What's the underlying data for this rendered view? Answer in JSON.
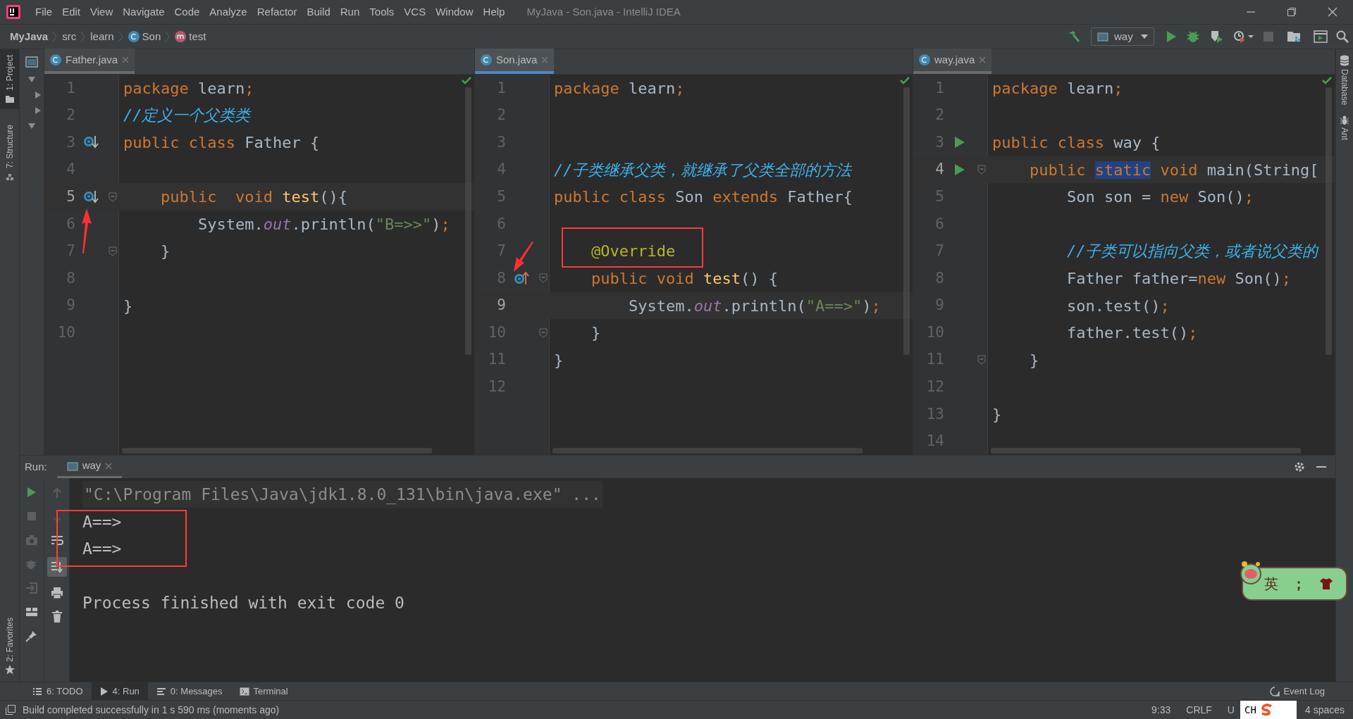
{
  "window": {
    "title": "MyJava - Son.java - IntelliJ IDEA"
  },
  "menu": [
    "File",
    "Edit",
    "View",
    "Navigate",
    "Code",
    "Analyze",
    "Refactor",
    "Build",
    "Run",
    "Tools",
    "VCS",
    "Window",
    "Help"
  ],
  "breadcrumb": [
    {
      "label": "MyJava",
      "kind": "project"
    },
    {
      "label": "src",
      "kind": "folder"
    },
    {
      "label": "learn",
      "kind": "folder"
    },
    {
      "label": "Son",
      "kind": "class"
    },
    {
      "label": "test",
      "kind": "method"
    }
  ],
  "run_config": "way",
  "left_tools": [
    {
      "label": "1: Project",
      "selected": true
    },
    {
      "label": "7: Structure",
      "selected": false
    }
  ],
  "favorites": "2: Favorites",
  "right_tools": [
    "Database",
    "Ant"
  ],
  "editors": [
    {
      "tab": "Father.java",
      "selected": false,
      "lines": [
        {
          "number": "1",
          "kind": "plain",
          "current": false,
          "fold": false,
          "tokens": [
            {
              "text": "package",
              "kind": "keyword"
            },
            {
              "text": " learn",
              "kind": "plain"
            },
            {
              "text": ";",
              "kind": "keyword"
            }
          ]
        },
        {
          "number": "2",
          "kind": "plain",
          "current": false,
          "fold": false,
          "tokens": [
            {
              "text": "//定义一个父类类",
              "kind": "comment"
            }
          ]
        },
        {
          "number": "3",
          "kind": "overridden",
          "current": false,
          "fold": false,
          "tokens": [
            {
              "text": "public class",
              "kind": "keyword"
            },
            {
              "text": " Father {",
              "kind": "plain"
            }
          ]
        },
        {
          "number": "4",
          "kind": "plain",
          "current": false,
          "fold": false
        },
        {
          "number": "5",
          "kind": "overridden",
          "current": true,
          "fold": true,
          "tokens": [
            {
              "text": "    public  void",
              "kind": "keyword"
            },
            {
              "text": " test",
              "kind": "method"
            },
            {
              "text": "(){",
              "kind": "plain"
            }
          ]
        },
        {
          "number": "6",
          "kind": "plain",
          "current": false,
          "fold": false,
          "tokens": [
            {
              "text": "        System.",
              "kind": "plain"
            },
            {
              "text": "out",
              "kind": "field"
            },
            {
              "text": ".println(",
              "kind": "plain"
            },
            {
              "text": "\"B=>>\"",
              "kind": "string"
            },
            {
              "text": ")",
              "kind": "plain"
            },
            {
              "text": ";",
              "kind": "keyword"
            }
          ]
        },
        {
          "number": "7",
          "kind": "plain",
          "current": false,
          "fold": true,
          "tokens": [
            {
              "text": "    }",
              "kind": "plain"
            }
          ]
        },
        {
          "number": "8",
          "kind": "plain",
          "current": false,
          "fold": false
        },
        {
          "number": "9",
          "kind": "plain",
          "current": false,
          "fold": false,
          "tokens": [
            {
              "text": "}",
              "kind": "plain"
            }
          ]
        },
        {
          "number": "10",
          "kind": "plain",
          "current": false,
          "fold": false
        }
      ]
    },
    {
      "tab": "Son.java",
      "selected": true,
      "lines": [
        {
          "number": "1",
          "kind": "plain",
          "current": false,
          "fold": false,
          "tokens": [
            {
              "text": "package",
              "kind": "keyword"
            },
            {
              "text": " learn",
              "kind": "plain"
            },
            {
              "text": ";",
              "kind": "keyword"
            }
          ]
        },
        {
          "number": "2",
          "kind": "plain",
          "current": false,
          "fold": false
        },
        {
          "number": "3",
          "kind": "plain",
          "current": false,
          "fold": false
        },
        {
          "number": "4",
          "kind": "plain",
          "current": false,
          "fold": false,
          "tokens": [
            {
              "text": "//子类继承父类，就继承了父类全部的方法",
              "kind": "comment"
            }
          ]
        },
        {
          "number": "5",
          "kind": "plain",
          "current": false,
          "fold": false,
          "tokens": [
            {
              "text": "public class",
              "kind": "keyword"
            },
            {
              "text": " Son ",
              "kind": "plain"
            },
            {
              "text": "extends",
              "kind": "keyword"
            },
            {
              "text": " Father{",
              "kind": "plain"
            }
          ]
        },
        {
          "number": "6",
          "kind": "plain",
          "current": false,
          "fold": false
        },
        {
          "number": "7",
          "kind": "plain",
          "current": false,
          "fold": false,
          "tokens": [
            {
              "text": "    @Override",
              "kind": "annotation"
            }
          ]
        },
        {
          "number": "8",
          "kind": "overrides",
          "current": false,
          "fold": true,
          "tokens": [
            {
              "text": "    public void",
              "kind": "keyword"
            },
            {
              "text": " test",
              "kind": "method"
            },
            {
              "text": "() {",
              "kind": "plain"
            }
          ]
        },
        {
          "number": "9",
          "kind": "plain",
          "current": true,
          "fold": false,
          "tokens": [
            {
              "text": "        System.",
              "kind": "plain"
            },
            {
              "text": "out",
              "kind": "field"
            },
            {
              "text": ".println(",
              "kind": "plain"
            },
            {
              "text": "\"A==>\"",
              "kind": "string"
            },
            {
              "text": ")",
              "kind": "plain"
            },
            {
              "text": ";",
              "kind": "keyword"
            }
          ]
        },
        {
          "number": "10",
          "kind": "plain",
          "current": false,
          "fold": true,
          "tokens": [
            {
              "text": "    }",
              "kind": "plain"
            }
          ]
        },
        {
          "number": "11",
          "kind": "plain",
          "current": false,
          "fold": false,
          "tokens": [
            {
              "text": "}",
              "kind": "plain"
            }
          ]
        },
        {
          "number": "12",
          "kind": "plain",
          "current": false,
          "fold": false
        }
      ]
    },
    {
      "tab": "way.java",
      "selected": false,
      "lines": [
        {
          "number": "1",
          "kind": "plain",
          "current": false,
          "fold": false,
          "tokens": [
            {
              "text": "package",
              "kind": "keyword"
            },
            {
              "text": " learn",
              "kind": "plain"
            },
            {
              "text": ";",
              "kind": "keyword"
            }
          ]
        },
        {
          "number": "2",
          "kind": "plain",
          "current": false,
          "fold": false
        },
        {
          "number": "3",
          "kind": "run",
          "current": false,
          "fold": false,
          "tokens": [
            {
              "text": "public class",
              "kind": "keyword"
            },
            {
              "text": " way {",
              "kind": "plain"
            }
          ]
        },
        {
          "number": "4",
          "kind": "run",
          "current": true,
          "fold": true,
          "tokens": [
            {
              "text": "    public ",
              "kind": "keyword"
            },
            {
              "text": "static",
              "kind": "keyword-highlighted"
            },
            {
              "text": " void",
              "kind": "keyword"
            },
            {
              "text": " main(String[",
              "kind": "plain"
            }
          ]
        },
        {
          "number": "5",
          "kind": "plain",
          "current": false,
          "fold": false,
          "tokens": [
            {
              "text": "        Son son = ",
              "kind": "plain"
            },
            {
              "text": "new",
              "kind": "keyword"
            },
            {
              "text": " Son()",
              "kind": "plain"
            },
            {
              "text": ";",
              "kind": "keyword"
            }
          ]
        },
        {
          "number": "6",
          "kind": "plain",
          "current": false,
          "fold": false
        },
        {
          "number": "7",
          "kind": "plain",
          "current": false,
          "fold": false,
          "tokens": [
            {
              "text": "        //子类可以指向父类，或者说父类的",
              "kind": "comment"
            }
          ]
        },
        {
          "number": "8",
          "kind": "plain",
          "current": false,
          "fold": false,
          "tokens": [
            {
              "text": "        Father father=",
              "kind": "plain"
            },
            {
              "text": "new",
              "kind": "keyword"
            },
            {
              "text": " Son()",
              "kind": "plain"
            },
            {
              "text": ";",
              "kind": "keyword"
            }
          ]
        },
        {
          "number": "9",
          "kind": "plain",
          "current": false,
          "fold": false,
          "tokens": [
            {
              "text": "        son.test()",
              "kind": "plain"
            },
            {
              "text": ";",
              "kind": "keyword"
            }
          ]
        },
        {
          "number": "10",
          "kind": "plain",
          "current": false,
          "fold": false,
          "tokens": [
            {
              "text": "        father.test()",
              "kind": "plain"
            },
            {
              "text": ";",
              "kind": "keyword"
            }
          ]
        },
        {
          "number": "11",
          "kind": "plain",
          "current": false,
          "fold": true,
          "tokens": [
            {
              "text": "    }",
              "kind": "plain"
            }
          ]
        },
        {
          "number": "12",
          "kind": "plain",
          "current": false,
          "fold": false
        },
        {
          "number": "13",
          "kind": "plain",
          "current": false,
          "fold": false,
          "tokens": [
            {
              "text": "}",
              "kind": "plain"
            }
          ]
        },
        {
          "number": "14",
          "kind": "plain",
          "current": false,
          "fold": false
        }
      ]
    }
  ],
  "run_panel": {
    "label": "Run:",
    "tab": "way",
    "console": [
      {
        "text": "\"C:\\Program Files\\Java\\jdk1.8.0_131\\bin\\java.exe\" ...",
        "kind": "command"
      },
      {
        "text": "A==>",
        "kind": "output"
      },
      {
        "text": "A==>",
        "kind": "output"
      },
      {
        "kind": "blank"
      },
      {
        "text": "Process finished with exit code 0",
        "kind": "output"
      }
    ]
  },
  "ime_bar": {
    "mode": "英",
    "punctuation": "；"
  },
  "bottom_tabs": [
    {
      "label": "6: TODO",
      "selected": false,
      "kind": "todo"
    },
    {
      "label": "4: Run",
      "selected": true,
      "kind": "run"
    },
    {
      "label": "0: Messages",
      "selected": false,
      "kind": "messages"
    },
    {
      "label": "Terminal",
      "selected": false,
      "kind": "terminal"
    }
  ],
  "event_log": "Event Log",
  "status_bar": {
    "message": "Build completed successfully in 1 s 590 ms (moments ago)",
    "position": "9:33",
    "line_separator": "CRLF",
    "encoding": "U",
    "input_indicator": "CH",
    "indent": "4 spaces"
  }
}
